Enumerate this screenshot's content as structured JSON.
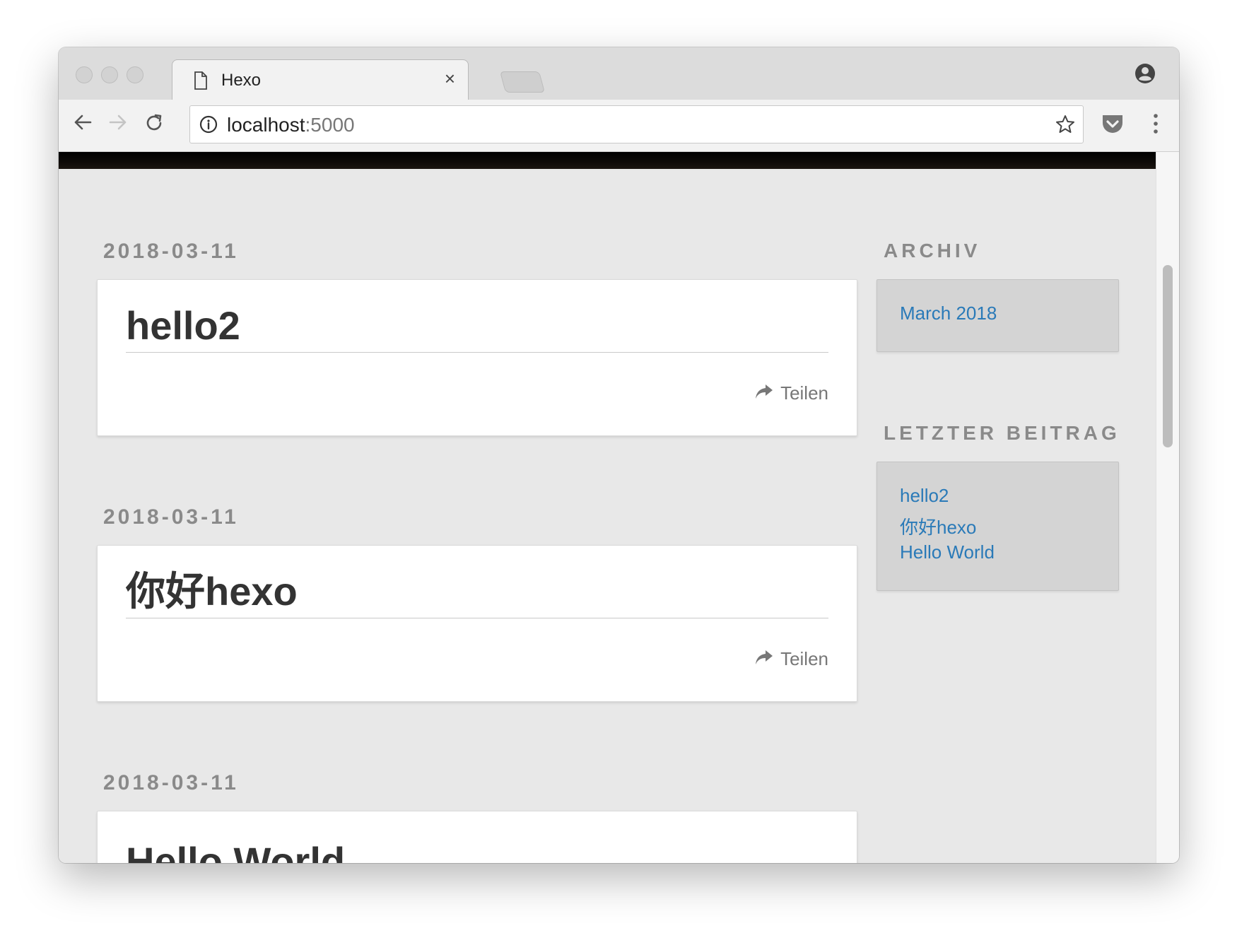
{
  "browser": {
    "tab_title": "Hexo",
    "tab_close": "×",
    "url_host": "localhost",
    "url_port": ":5000"
  },
  "posts": [
    {
      "date": "2018-03-11",
      "title": "hello2",
      "share_label": "Teilen"
    },
    {
      "date": "2018-03-11",
      "title": "你好hexo",
      "share_label": "Teilen"
    },
    {
      "date": "2018-03-11",
      "title": "Hello World"
    }
  ],
  "sidebar": {
    "archive": {
      "heading": "ARCHIV",
      "links": [
        "March 2018"
      ]
    },
    "recent": {
      "heading": "LETZTER BEITRAG",
      "links": [
        "hello2",
        "你好hexo",
        "Hello World"
      ]
    }
  },
  "colors": {
    "page_background": "#e8e8e8",
    "link": "#2a7ab8",
    "muted_text": "#8a8a8a",
    "title_text": "#333333"
  }
}
